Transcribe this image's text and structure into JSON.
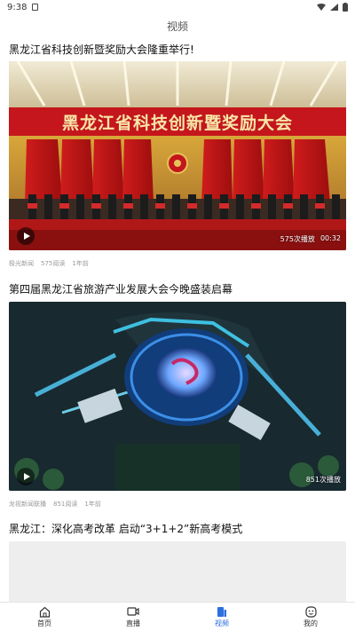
{
  "status": {
    "time": "9:38"
  },
  "header": {
    "title": "视频"
  },
  "videos": [
    {
      "title": "黑龙江省科技创新暨奖励大会隆重举行!",
      "source": "极光新闻",
      "reads": "575阅读",
      "time_ago": "1年前",
      "plays": "575次播放",
      "duration": "00:32",
      "banner_text": "黑龙江省科技创新暨奖励大会"
    },
    {
      "title": "第四届黑龙江省旅游产业发展大会今晚盛装启幕",
      "source": "龙视新闻联播",
      "reads": "851阅读",
      "time_ago": "1年前",
      "plays": "851次播放"
    },
    {
      "title": "黑龙江：深化高考改革 启动“3+1+2”新高考模式"
    }
  ],
  "tabs": [
    {
      "label": "首页",
      "icon": "home-icon"
    },
    {
      "label": "直播",
      "icon": "live-icon"
    },
    {
      "label": "视频",
      "icon": "video-icon"
    },
    {
      "label": "我的",
      "icon": "profile-icon"
    }
  ],
  "active_tab": "视频",
  "colors": {
    "accent": "#2b6fe0",
    "banner_red": "#c4161c"
  }
}
